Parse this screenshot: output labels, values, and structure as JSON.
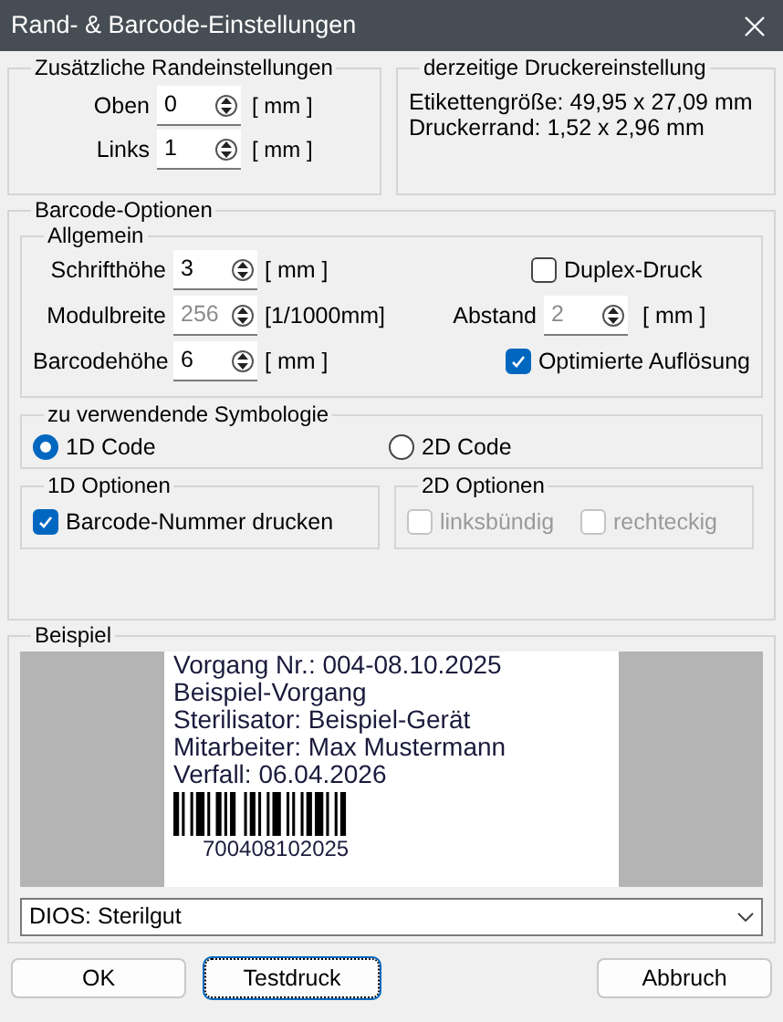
{
  "window": {
    "title": "Rand- & Barcode-Einstellungen"
  },
  "margins": {
    "legend": "Zusätzliche Randeinstellungen",
    "fields": [
      {
        "label": "Oben",
        "value": "0",
        "unit": "[ mm ]",
        "disabled": false
      },
      {
        "label": "Links",
        "value": "1",
        "unit": "[ mm ]",
        "disabled": false
      }
    ]
  },
  "printer": {
    "legend": "derzeitige Druckereinstellung",
    "lines": [
      "Etikettengröße: 49,95 x 27,09 mm",
      "Druckerrand: 1,52 x 2,96 mm"
    ]
  },
  "barcode_options": {
    "legend": "Barcode-Optionen",
    "general": {
      "legend": "Allgemein",
      "fields": [
        {
          "label": "Schrifthöhe",
          "value": "3",
          "unit": "[ mm ]",
          "disabled": false
        },
        {
          "label": "Modulbreite",
          "value": "256",
          "unit": "[1/1000mm]",
          "disabled": true
        },
        {
          "label": "Barcodehöhe",
          "value": "6",
          "unit": "[ mm ]",
          "disabled": false
        }
      ],
      "duplex": {
        "label": "Duplex-Druck",
        "checked": false
      },
      "spacing": {
        "label": "Abstand",
        "value": "2",
        "unit": "[ mm ]",
        "disabled": true
      },
      "optimized": {
        "label": "Optimierte Auflösung",
        "checked": true
      }
    },
    "symbology": {
      "legend": "zu verwendende Symbologie",
      "options": [
        {
          "label": "1D Code",
          "selected": true
        },
        {
          "label": "2D Code",
          "selected": false
        }
      ]
    },
    "options_1d": {
      "legend": "1D Optionen",
      "checkboxes": [
        {
          "label": "Barcode-Nummer drucken",
          "checked": true,
          "disabled": false
        }
      ]
    },
    "options_2d": {
      "legend": "2D Optionen",
      "checkboxes": [
        {
          "label": "linksbündig",
          "checked": false,
          "disabled": true
        },
        {
          "label": "rechteckig",
          "checked": false,
          "disabled": true
        }
      ]
    }
  },
  "example": {
    "legend": "Beispiel",
    "label_lines": [
      "Vorgang Nr.: 004-08.10.2025",
      "Beispiel-Vorgang",
      "Sterilisator: Beispiel-Gerät",
      "Mitarbeiter: Max Mustermann",
      "Verfall: 06.04.2026"
    ],
    "barcode_number": "700408102025",
    "template": "DIOS: Sterilgut"
  },
  "buttons": [
    {
      "label": "OK",
      "focused": false
    },
    {
      "label": "Testdruck",
      "focused": true
    },
    {
      "label": "Abbruch",
      "focused": false
    }
  ]
}
